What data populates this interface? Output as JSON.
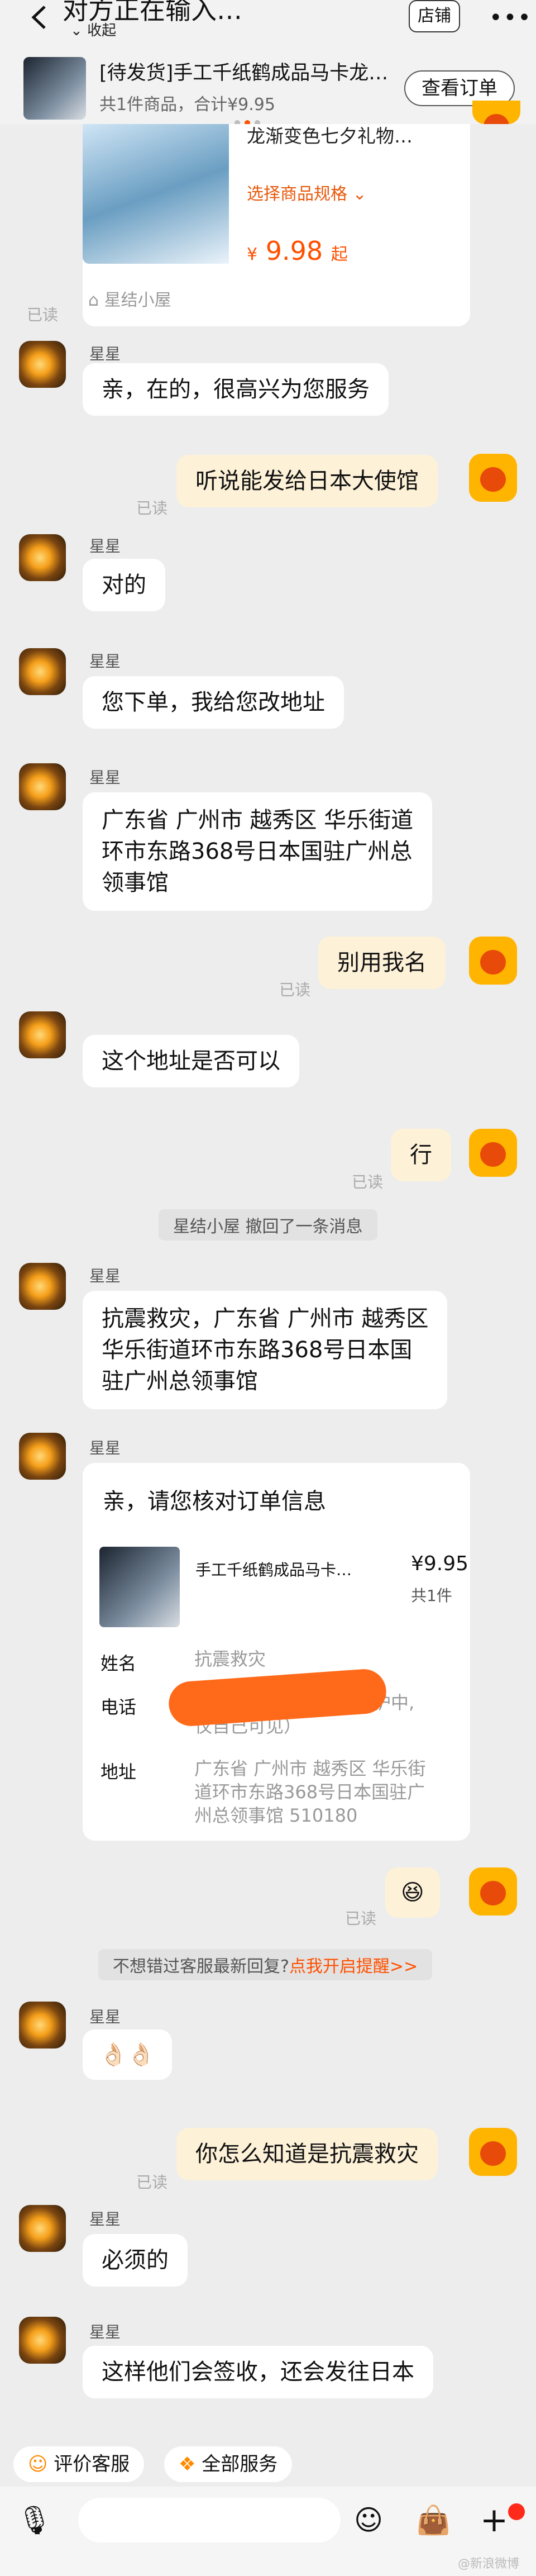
{
  "header": {
    "title": "对方正在输入…",
    "collapse": "收起",
    "store_button": "店铺",
    "more": "•••"
  },
  "order_banner": {
    "name": "[待发货]手工千纸鹤成品马卡龙…",
    "info": "共1件商品，合计¥9.95",
    "view_order": "查看订单"
  },
  "product_card": {
    "name": "龙渐变色七夕礼物…",
    "spec": "选择商品规格 ⌄",
    "price_symbol": "¥",
    "price": "9.98",
    "price_suffix": "起",
    "store": "星结小屋",
    "store_icon": "store-icon"
  },
  "messages": {
    "read": "已读",
    "sender_name": "星星",
    "m1": "亲，在的，很高兴为您服务",
    "m2": "听说能发给日本大使馆",
    "m3": "对的",
    "m4": "您下单，我给您改地址",
    "m5_l1": "广东省 广州市 越秀区 华乐街道",
    "m5_l2": "环市东路368号日本国驻广州总",
    "m5_l3": "领事馆",
    "m6": "别用我名",
    "m7": "这个地址是否可以",
    "m8": "行",
    "sys1": "星结小屋 撤回了一条消息",
    "m9_l1": "抗震救灾，广东省 广州市 越秀区",
    "m9_l2": "华乐街道环市东路368号日本国",
    "m9_l3": "驻广州总领事馆",
    "m10": "😆",
    "sys2_text": "不想错过客服最新回复?",
    "sys2_link": "点我开启提醒>>",
    "m11": "👌🏻👌🏻",
    "m12": "你怎么知道是抗震救灾",
    "m13": "必须的",
    "m14": "这样他们会签收，还会发往日本"
  },
  "order_confirm": {
    "title": "亲，请您核对订单信息",
    "product_name": "手工千纸鹤成品马卡…",
    "price": "¥9.95",
    "qty": "共1件",
    "name_label": "姓名",
    "name_value": "抗震救灾",
    "phone_label": "电话",
    "phone_value_l1": "护中,",
    "phone_value_l2": "仅自己可见）",
    "address_label": "地址",
    "address_l1": "广东省 广州市 越秀区 华乐街",
    "address_l2": "道环市东路368号日本国驻广",
    "address_l3": "州总领事馆 510180"
  },
  "quick_actions": {
    "rate": "评价客服",
    "all_services": "全部服务"
  },
  "input_bar": {
    "voice_icon": "microphone-icon",
    "emoji_icon": "smiley-icon",
    "bag_icon": "shopping-bag-icon",
    "plus_icon": "plus-icon"
  },
  "watermark": "@新浪微博"
}
